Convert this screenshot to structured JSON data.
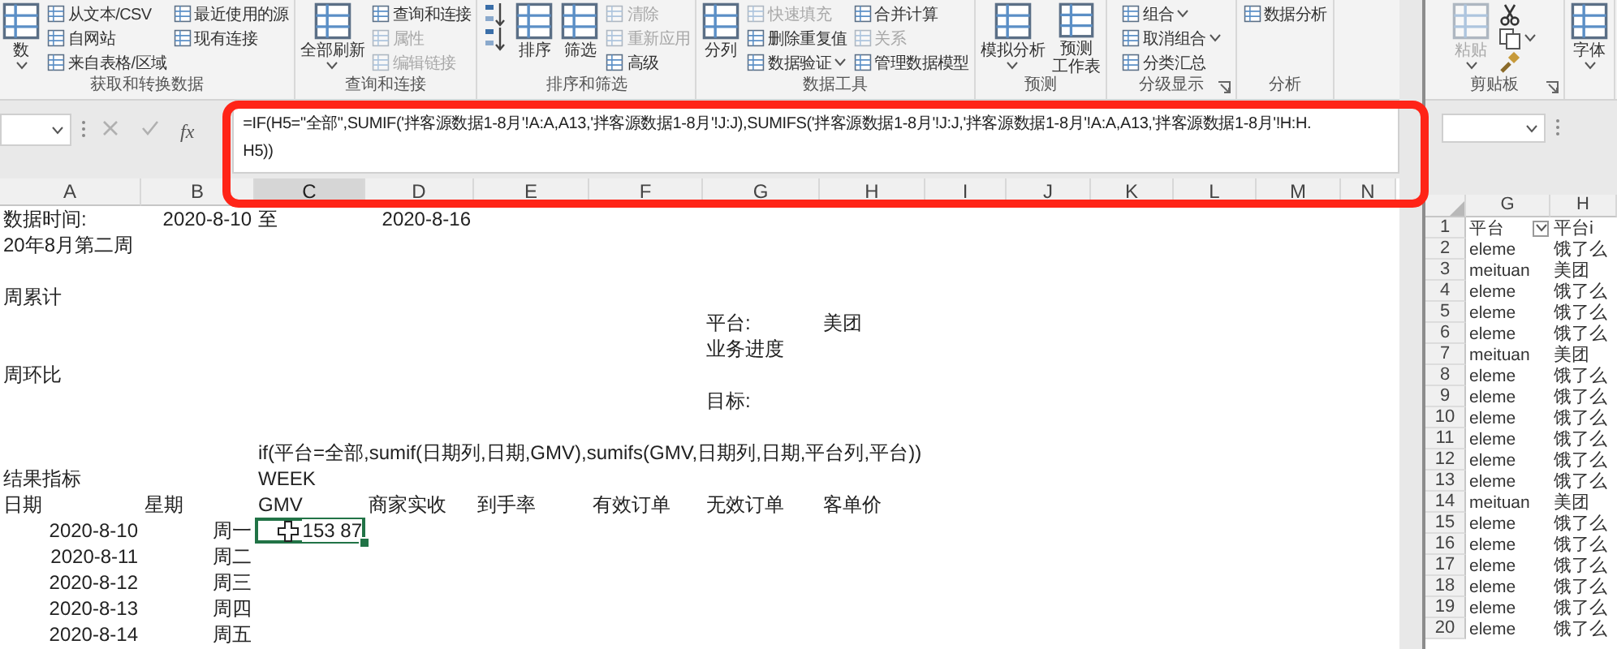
{
  "ribbon": {
    "groups": [
      {
        "label": "获取和转换数据",
        "launcher": false,
        "columns": [
          {
            "kind": "large",
            "items": [
              {
                "label": "数",
                "disabled": false,
                "dropdown": true
              }
            ]
          },
          {
            "kind": "stack",
            "items": [
              {
                "label": "从文本/CSV",
                "disabled": false,
                "dropdown": false
              },
              {
                "label": "自网站",
                "disabled": false,
                "dropdown": false
              },
              {
                "label": "来自表格/区域",
                "disabled": false,
                "dropdown": false
              }
            ]
          },
          {
            "kind": "stack",
            "items": [
              {
                "label": "最近使用的源",
                "disabled": false,
                "dropdown": false
              },
              {
                "label": "现有连接",
                "disabled": false,
                "dropdown": false
              }
            ]
          }
        ]
      },
      {
        "label": "查询和连接",
        "launcher": false,
        "columns": [
          {
            "kind": "large",
            "items": [
              {
                "label": "全部刷新",
                "disabled": false,
                "dropdown": true
              }
            ]
          },
          {
            "kind": "stack",
            "items": [
              {
                "label": "查询和连接",
                "disabled": false,
                "dropdown": false
              },
              {
                "label": "属性",
                "disabled": true,
                "dropdown": false
              },
              {
                "label": "编辑链接",
                "disabled": true,
                "dropdown": false
              }
            ]
          }
        ]
      },
      {
        "label": "排序和筛选",
        "launcher": false,
        "columns": [
          {
            "kind": "icons",
            "items": [
              {
                "disabled": false,
                "dropdown": false
              },
              {
                "disabled": false,
                "dropdown": false
              }
            ]
          },
          {
            "kind": "large",
            "items": [
              {
                "label": "排序",
                "disabled": false,
                "dropdown": false
              }
            ]
          },
          {
            "kind": "large",
            "items": [
              {
                "label": "筛选",
                "disabled": false,
                "dropdown": false
              }
            ]
          },
          {
            "kind": "stack",
            "items": [
              {
                "label": "清除",
                "disabled": true,
                "dropdown": false
              },
              {
                "label": "重新应用",
                "disabled": true,
                "dropdown": false
              },
              {
                "label": "高级",
                "disabled": false,
                "dropdown": false
              }
            ]
          }
        ]
      },
      {
        "label": "数据工具",
        "launcher": false,
        "columns": [
          {
            "kind": "large",
            "items": [
              {
                "label": "分列",
                "disabled": false,
                "dropdown": false
              }
            ]
          },
          {
            "kind": "stack",
            "items": [
              {
                "label": "快速填充",
                "disabled": true,
                "dropdown": false
              },
              {
                "label": "删除重复值",
                "disabled": false,
                "dropdown": false
              },
              {
                "label": "数据验证",
                "disabled": false,
                "dropdown": true
              }
            ]
          },
          {
            "kind": "stack",
            "items": [
              {
                "label": "合并计算",
                "disabled": false,
                "dropdown": false
              },
              {
                "label": "关系",
                "disabled": true,
                "dropdown": false
              },
              {
                "label": "管理数据模型",
                "disabled": false,
                "dropdown": false
              }
            ]
          }
        ]
      },
      {
        "label": "预测",
        "launcher": false,
        "columns": [
          {
            "kind": "large",
            "items": [
              {
                "label": "模拟分析",
                "disabled": false,
                "dropdown": true
              }
            ]
          },
          {
            "kind": "large",
            "items": [
              {
                "lines": [
                  "预测",
                  "工作表"
                ],
                "disabled": false,
                "dropdown": false
              }
            ]
          }
        ]
      },
      {
        "label": "分级显示",
        "launcher": true,
        "columns": [
          {
            "kind": "stack",
            "items": [
              {
                "label": "组合",
                "disabled": false,
                "dropdown": true
              },
              {
                "label": "取消组合",
                "disabled": false,
                "dropdown": true
              },
              {
                "label": "分类汇总",
                "disabled": false,
                "dropdown": false
              }
            ]
          }
        ]
      },
      {
        "label": "分析",
        "launcher": false,
        "columns": [
          {
            "kind": "stack",
            "items": [
              {
                "label": "数据分析",
                "disabled": false,
                "dropdown": false
              }
            ]
          }
        ]
      }
    ]
  },
  "formula_bar": {
    "fx": "fx",
    "lines": [
      "=IF(H5=\"全部\",SUMIF('拌客源数据1-8月'!A:A,A13,'拌客源数据1-8月'!J:J),SUMIFS('拌客源数据1-8月'!J:J,'拌客源数据1-8月'!A:A,A13,'拌客源数据1-8月'!H:H.",
      "H5))"
    ]
  },
  "sheet": {
    "columns": [
      {
        "label": "A",
        "selected": false
      },
      {
        "label": "B",
        "selected": false
      },
      {
        "label": "C",
        "selected": true
      },
      {
        "label": "D",
        "selected": false
      },
      {
        "label": "E",
        "selected": false
      },
      {
        "label": "F",
        "selected": false
      },
      {
        "label": "G",
        "selected": false
      },
      {
        "label": "H",
        "selected": false
      },
      {
        "label": "I",
        "selected": false
      },
      {
        "label": "J",
        "selected": false
      },
      {
        "label": "K",
        "selected": false
      },
      {
        "label": "L",
        "selected": false
      },
      {
        "label": "M",
        "selected": false
      },
      {
        "label": "N",
        "selected": false
      }
    ],
    "rows": [
      {
        "cells": [
          {
            "text": "数据时间:",
            "selected": false
          },
          {
            "text": "2020-8-10",
            "selected": false
          },
          {
            "text": "至",
            "selected": false
          },
          {
            "text": "2020-8-16",
            "selected": false
          }
        ]
      },
      {
        "cells": [
          {
            "text": "20年8月第二周",
            "selected": false
          }
        ]
      },
      {},
      {
        "cells": [
          {
            "text": "周累计",
            "selected": false
          }
        ]
      },
      {
        "cells": [
          null,
          null,
          null,
          null,
          null,
          null,
          {
            "text": "平台:",
            "selected": false
          },
          {
            "text": "美团",
            "selected": false
          }
        ]
      },
      {
        "cells": [
          null,
          null,
          null,
          null,
          null,
          null,
          {
            "text": "业务进度",
            "selected": false
          }
        ]
      },
      {
        "cells": [
          {
            "text": "周环比",
            "selected": false
          }
        ]
      },
      {
        "cells": [
          null,
          null,
          null,
          null,
          null,
          null,
          {
            "text": "目标:",
            "selected": false
          }
        ]
      },
      {},
      {
        "cells": [
          null,
          null,
          {
            "text": "if(平台=全部,sumif(日期列,日期,GMV),sumifs(GMV,日期列,日期,平台列,平台))",
            "selected": false
          }
        ]
      },
      {
        "cells": [
          {
            "text": "结果指标",
            "selected": false
          },
          null,
          {
            "text": "WEEK",
            "selected": false
          }
        ]
      },
      {
        "cells": [
          {
            "text": "日期",
            "selected": false
          },
          {
            "text": "星期",
            "selected": false
          },
          {
            "text": "GMV",
            "selected": false
          },
          {
            "text": "商家实收",
            "selected": false
          },
          {
            "text": "到手率",
            "selected": false
          },
          {
            "text": "有效订单",
            "selected": false
          },
          {
            "text": "无效订单",
            "selected": false
          },
          {
            "text": "客单价",
            "selected": false
          }
        ]
      },
      {
        "cells": [
          {
            "text": "2020-8-10",
            "selected": false
          },
          {
            "text": "周一",
            "selected": false
          },
          {
            "text": "153 87",
            "selected": true
          }
        ]
      },
      {
        "cells": [
          {
            "text": "2020-8-11",
            "selected": false
          },
          {
            "text": "周二",
            "selected": false
          }
        ]
      },
      {
        "cells": [
          {
            "text": "2020-8-12",
            "selected": false
          },
          {
            "text": "周三",
            "selected": false
          }
        ]
      },
      {
        "cells": [
          {
            "text": "2020-8-13",
            "selected": false
          },
          {
            "text": "周四",
            "selected": false
          }
        ]
      },
      {
        "cells": [
          {
            "text": "2020-8-14",
            "selected": false
          },
          {
            "text": "周五",
            "selected": false
          }
        ]
      }
    ]
  },
  "side_window": {
    "ribbon": {
      "groups": [
        {
          "label": "剪贴板",
          "launcher": true,
          "columns": [
            {
              "kind": "large",
              "items": [
                {
                  "label": "粘贴",
                  "disabled": true,
                  "dropdown": true
                }
              ]
            },
            {
              "kind": "icons",
              "items": [
                {
                  "disabled": false,
                  "dropdown": false
                },
                {
                  "disabled": false,
                  "dropdown": true
                },
                {
                  "disabled": false,
                  "dropdown": false
                }
              ]
            }
          ]
        },
        {
          "launcher": false,
          "columns": [
            {
              "kind": "large",
              "items": [
                {
                  "label": "字体",
                  "disabled": false,
                  "dropdown": true
                }
              ]
            }
          ]
        }
      ]
    },
    "sheet": {
      "columns": [
        {
          "label": "G"
        },
        {
          "label": "H"
        }
      ],
      "rows": [
        {
          "number": "1",
          "kind": "header",
          "platform": "平台",
          "name": "平台i"
        },
        {
          "number": "2",
          "kind": "data",
          "platform": "eleme",
          "name": "饿了么"
        },
        {
          "number": "3",
          "kind": "data",
          "platform": "meituan",
          "name": "美团"
        },
        {
          "number": "4",
          "kind": "data",
          "platform": "eleme",
          "name": "饿了么"
        },
        {
          "number": "5",
          "kind": "data",
          "platform": "eleme",
          "name": "饿了么"
        },
        {
          "number": "6",
          "kind": "data",
          "platform": "eleme",
          "name": "饿了么"
        },
        {
          "number": "7",
          "kind": "data",
          "platform": "meituan",
          "name": "美团"
        },
        {
          "number": "8",
          "kind": "data",
          "platform": "eleme",
          "name": "饿了么"
        },
        {
          "number": "9",
          "kind": "data",
          "platform": "eleme",
          "name": "饿了么"
        },
        {
          "number": "10",
          "kind": "data",
          "platform": "eleme",
          "name": "饿了么"
        },
        {
          "number": "11",
          "kind": "data",
          "platform": "eleme",
          "name": "饿了么"
        },
        {
          "number": "12",
          "kind": "data",
          "platform": "eleme",
          "name": "饿了么"
        },
        {
          "number": "13",
          "kind": "data",
          "platform": "eleme",
          "name": "饿了么"
        },
        {
          "number": "14",
          "kind": "data",
          "platform": "meituan",
          "name": "美团"
        },
        {
          "number": "15",
          "kind": "data",
          "platform": "eleme",
          "name": "饿了么"
        },
        {
          "number": "16",
          "kind": "data",
          "platform": "eleme",
          "name": "饿了么"
        },
        {
          "number": "17",
          "kind": "data",
          "platform": "eleme",
          "name": "饿了么"
        },
        {
          "number": "18",
          "kind": "data",
          "platform": "eleme",
          "name": "饿了么"
        },
        {
          "number": "19",
          "kind": "data",
          "platform": "eleme",
          "name": "饿了么"
        },
        {
          "number": "20",
          "kind": "data",
          "platform": "eleme",
          "name": "饿了么"
        }
      ]
    }
  }
}
